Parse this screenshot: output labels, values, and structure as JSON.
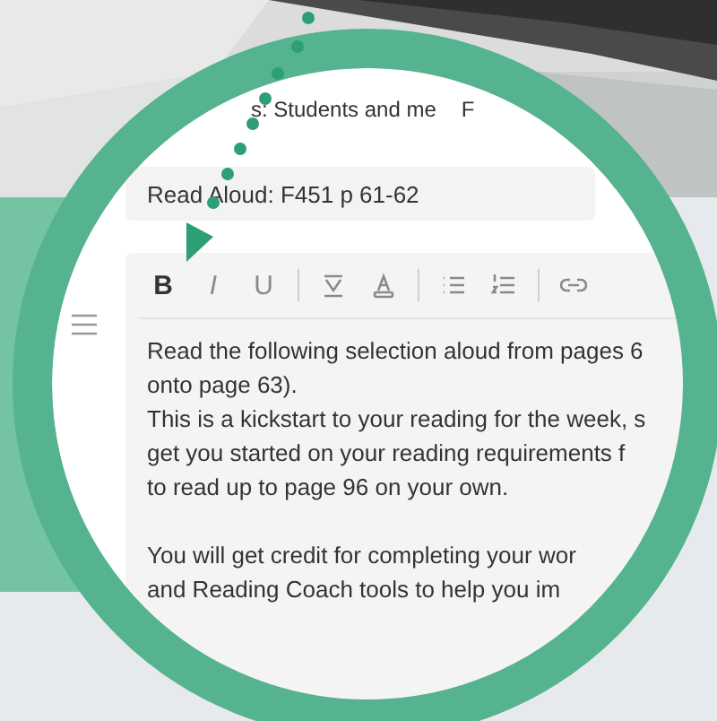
{
  "assign_row": {
    "text": "s: Students and me",
    "column_2": "F"
  },
  "title_field": {
    "value": "Read Aloud: F451 p 61-62"
  },
  "toolbar_groups": [
    [
      {
        "kind": "bold",
        "label": "B"
      },
      {
        "kind": "italic",
        "label": "I"
      },
      {
        "kind": "underline",
        "label": "U"
      }
    ],
    [
      {
        "kind": "highlight"
      },
      {
        "kind": "font-color"
      }
    ],
    [
      {
        "kind": "bullets"
      },
      {
        "kind": "numbering"
      }
    ],
    [
      {
        "kind": "link"
      }
    ]
  ],
  "paragraphs": [
    [
      "Read the following selection aloud from pages 6",
      "onto page 63).",
      "This is a kickstart to your reading for the week, s",
      "get you started on your reading requirements f",
      "to read up to page 96 on your own."
    ],
    [
      "You will get credit for completing your wor",
      "and Reading Coach tools to help you im"
    ]
  ]
}
